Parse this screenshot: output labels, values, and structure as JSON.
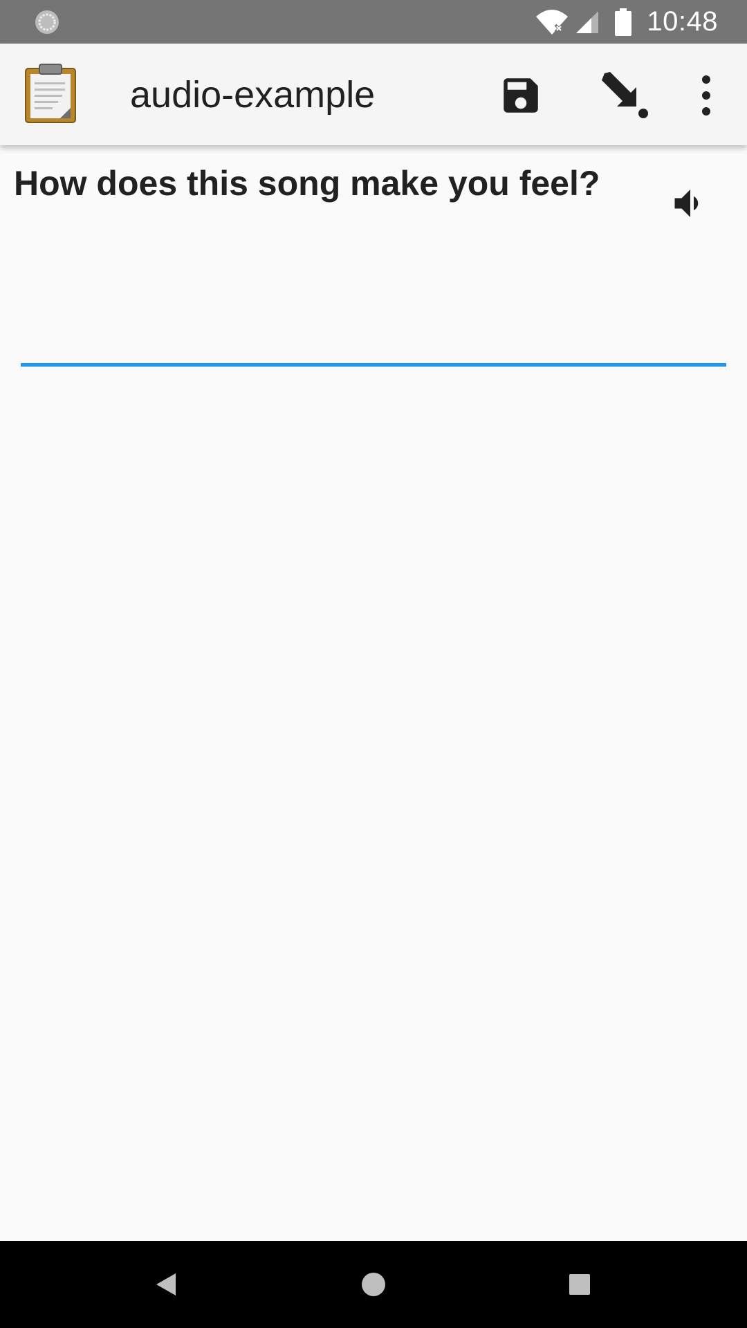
{
  "status_bar": {
    "time": "10:48",
    "icons": [
      "sync-icon",
      "wifi-icon",
      "signal-icon",
      "battery-icon"
    ]
  },
  "app_bar": {
    "title": "audio-example",
    "actions": [
      "save-icon",
      "goto-icon",
      "more-vert-icon"
    ]
  },
  "question": {
    "label": "How does this song make you feel?",
    "audio_icon": "volume-icon",
    "answer_value": "",
    "underline_color": "#2196f3"
  },
  "nav_bar": {
    "icons": [
      "back-icon",
      "home-icon",
      "recents-icon"
    ]
  },
  "colors": {
    "status_bar": "#757575",
    "app_bar": "#f5f5f5",
    "background": "#fafafa",
    "accent": "#2196f3"
  }
}
